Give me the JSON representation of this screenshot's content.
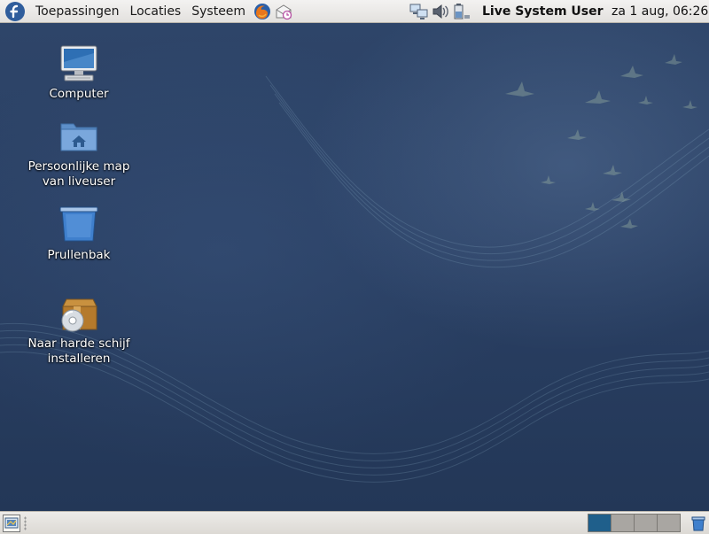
{
  "top_panel": {
    "menus": [
      {
        "label": "Toepassingen"
      },
      {
        "label": "Locaties"
      },
      {
        "label": "Systeem"
      }
    ],
    "user_name": "Live System User",
    "clock": "za  1 aug, 06:26",
    "icons": {
      "logo": "fedora-logo-icon",
      "browser": "firefox-icon",
      "mail": "evolution-mail-icon",
      "network": "network-icon",
      "volume": "volume-icon",
      "power": "battery-icon"
    }
  },
  "desktop": {
    "icons": [
      {
        "label": "Computer",
        "icon": "computer-icon"
      },
      {
        "label": "Persoonlijke map\nvan liveuser",
        "icon": "home-folder-icon"
      },
      {
        "label": "Prullenbak",
        "icon": "trash-icon"
      },
      {
        "label": "Naar harde schijf\ninstalleren",
        "icon": "install-package-icon"
      }
    ]
  },
  "bottom_panel": {
    "workspaces": [
      {
        "active": true
      },
      {
        "active": false
      },
      {
        "active": false
      },
      {
        "active": false
      }
    ]
  },
  "colors": {
    "wallpaper": "#2a4064",
    "panel": "#e8e6e3",
    "active_workspace": "#1f5f8b",
    "fedora_blue": "#2f5d9c"
  }
}
